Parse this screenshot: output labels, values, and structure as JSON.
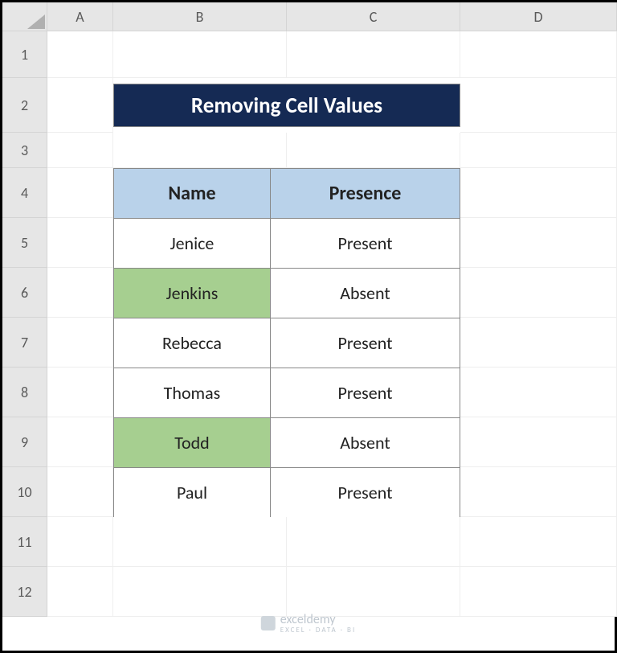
{
  "columns": [
    "A",
    "B",
    "C",
    "D"
  ],
  "rows": [
    "1",
    "2",
    "3",
    "4",
    "5",
    "6",
    "7",
    "8",
    "9",
    "10",
    "11",
    "12"
  ],
  "title": "Removing Cell Values",
  "table": {
    "headers": [
      "Name",
      "Presence"
    ],
    "data": [
      {
        "name": "Jenice",
        "presence": "Present",
        "highlight": false
      },
      {
        "name": "Jenkins",
        "presence": "Absent",
        "highlight": true
      },
      {
        "name": "Rebecca",
        "presence": "Present",
        "highlight": false
      },
      {
        "name": "Thomas",
        "presence": "Present",
        "highlight": false
      },
      {
        "name": "Todd",
        "presence": "Absent",
        "highlight": true
      },
      {
        "name": "Paul",
        "presence": "Present",
        "highlight": false
      }
    ]
  },
  "watermark": {
    "brand": "exceldemy",
    "tagline": "EXCEL · DATA · BI"
  }
}
